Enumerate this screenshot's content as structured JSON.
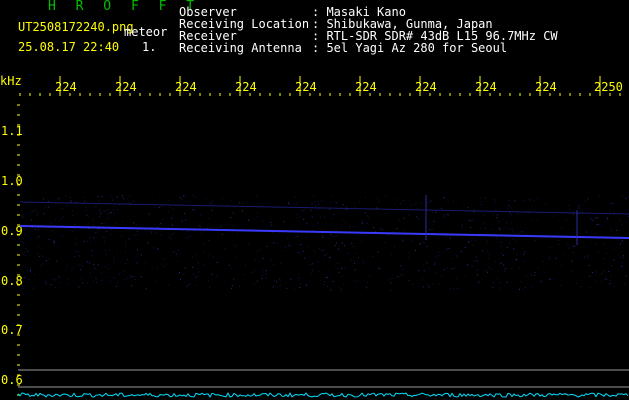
{
  "header": {
    "app_title": "H R O F F T",
    "filename": "UT2508172240.png",
    "mode": "meteor",
    "datetime": "25.08.17 22:40",
    "page_index": "1.",
    "info": [
      {
        "label": "Observer",
        "value": ": Masaki Kano"
      },
      {
        "label": "Receiving Location",
        "value": ": Shibukawa, Gunma, Japan"
      },
      {
        "label": "Receiver",
        "value": ": RTL-SDR SDR# 43dB L15 96.7MHz CW"
      },
      {
        "label": "Receiving Antenna",
        "value": ": 5el Yagi Az 280 for Seoul"
      }
    ]
  },
  "axis": {
    "unit": "kHz",
    "time_ticks": [
      "224",
      "224",
      "224",
      "224",
      "224",
      "224",
      "224",
      "224",
      "224",
      "2250"
    ],
    "freq_ticks": [
      "1.1",
      "1.0",
      "0.9",
      "0.8",
      "0.7",
      "0.6"
    ]
  },
  "colors": {
    "background": "#000000",
    "text_info": "#ffffff",
    "title": "#00c000",
    "axis": "#ffff00",
    "signal": "#3a3aff",
    "noise": "#00e0ff"
  }
}
